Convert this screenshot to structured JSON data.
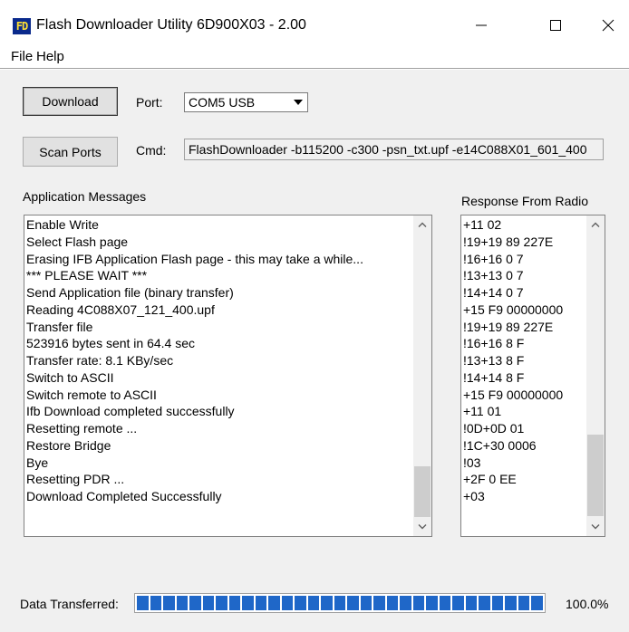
{
  "window": {
    "title": "Flash Downloader Utility 6D900X03 - 2.00",
    "icon_text": "FD",
    "controls": {
      "minimize": "minimize-icon",
      "maximize": "maximize-icon",
      "close": "close-icon"
    }
  },
  "menu": {
    "items": [
      {
        "label": "File"
      },
      {
        "label": "Help"
      }
    ]
  },
  "toolbar": {
    "download_label": "Download",
    "scan_label": "Scan Ports",
    "port_label": "Port:",
    "port_value": "COM5 USB",
    "cmd_label": "Cmd:",
    "cmd_value": "FlashDownloader -b115200 -c300 -psn_txt.upf -e14C088X01_601_400"
  },
  "messages": {
    "label": "Application Messages",
    "lines": [
      "Enable Write",
      "Select Flash page",
      "Erasing IFB Application Flash page - this may take a while...",
      "*** PLEASE WAIT ***",
      "Send Application file (binary transfer)",
      "Reading  4C088X07_121_400.upf",
      "Transfer file",
      "523916 bytes sent in 64.4 sec",
      "Transfer rate: 8.1 KBy/sec",
      "Switch to ASCII",
      "Switch remote to ASCII",
      "Ifb Download completed successfully",
      "Resetting remote ...",
      "Restore Bridge",
      "Bye",
      "Resetting PDR ...",
      "Download Completed Successfully"
    ]
  },
  "response": {
    "label": "Response From Radio",
    "lines": [
      "+11 02",
      "!19+19 89 227E",
      "!16+16 0 7",
      "!13+13 0 7",
      "!14+14 0 7",
      "+15 F9 00000000",
      "!19+19 89 227E",
      "!16+16 8 F",
      "!13+13 8 F",
      "!14+14 8 F",
      "+15 F9 00000000",
      "+11 01",
      "!0D+0D 01",
      "!1C+30 0006",
      "!03",
      "+2F 0 EE",
      "+03"
    ]
  },
  "status": {
    "label": "Data Transferred:",
    "progress_fraction": 1.0,
    "percent_text": "100.0%",
    "bar_color": "#1f67c8"
  }
}
